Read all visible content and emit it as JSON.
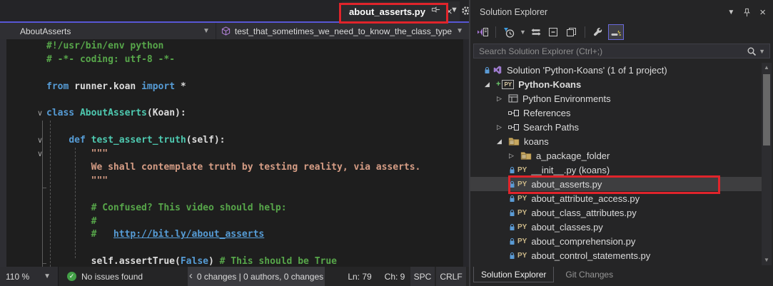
{
  "window": {
    "tab": {
      "title": "about_asserts.py"
    },
    "navbar": {
      "scope": "AboutAsserts",
      "member": "test_that_sometimes_we_need_to_know_the_class_type"
    }
  },
  "editor": {
    "lines": [
      {
        "tokens": [
          [
            "c",
            "#!/usr/bin/env python"
          ]
        ]
      },
      {
        "tokens": [
          [
            "c",
            "# -*- coding: utf-8 -*-"
          ]
        ]
      },
      {
        "tokens": []
      },
      {
        "tokens": [
          [
            "k",
            "from"
          ],
          [
            "p",
            " runner.koan "
          ],
          [
            "k",
            "import"
          ],
          [
            "p",
            " *"
          ]
        ]
      },
      {
        "tokens": []
      },
      {
        "fold": true,
        "tokens": [
          [
            "k",
            "class"
          ],
          [
            "p",
            " "
          ],
          [
            "t",
            "AboutAsserts"
          ],
          [
            "p",
            "(Koan):"
          ]
        ]
      },
      {
        "tokens": []
      },
      {
        "fold": true,
        "tokens": [
          [
            "p",
            "    "
          ],
          [
            "k",
            "def"
          ],
          [
            "p",
            " "
          ],
          [
            "t",
            "test_assert_truth"
          ],
          [
            "p",
            "(self):"
          ]
        ]
      },
      {
        "fold": true,
        "tokens": [
          [
            "s",
            "        \"\"\""
          ]
        ]
      },
      {
        "tokens": [
          [
            "s",
            "        We shall contemplate truth by testing reality, via asserts."
          ]
        ]
      },
      {
        "tokens": [
          [
            "s",
            "        \"\"\""
          ]
        ]
      },
      {
        "tokens": []
      },
      {
        "tokens": [
          [
            "c",
            "        # Confused? This video should help:"
          ]
        ]
      },
      {
        "tokens": [
          [
            "c",
            "        #"
          ]
        ]
      },
      {
        "tokens": [
          [
            "c",
            "        #   "
          ],
          [
            "l",
            "http://bit.ly/about_asserts"
          ]
        ]
      },
      {
        "tokens": []
      },
      {
        "tokens": [
          [
            "p",
            "        self.assertTrue("
          ],
          [
            "k",
            "False"
          ],
          [
            "p",
            ") "
          ],
          [
            "c",
            "# This should be True"
          ]
        ]
      }
    ]
  },
  "status_bar": {
    "zoom": "110 %",
    "message": "No issues found",
    "changes": "0 changes | 0 authors, 0 changes",
    "line": "Ln: 79",
    "column": "Ch: 9",
    "spaces": "SPC",
    "line_endings": "CRLF"
  },
  "solution_explorer": {
    "title": "Solution Explorer",
    "search_placeholder": "Search Solution Explorer (Ctrl+;)",
    "toolbar": [
      {
        "icon": "switch-views-icon"
      },
      {
        "separator": true
      },
      {
        "icon": "pending-changes-filter-icon",
        "dropdown": true
      },
      {
        "icon": "sync-with-active-document-icon"
      },
      {
        "icon": "collapse-all-icon"
      },
      {
        "icon": "show-all-files-icon"
      },
      {
        "separator": true
      },
      {
        "icon": "properties-icon"
      },
      {
        "icon": "track-active-item-icon",
        "active": true
      }
    ],
    "tree": [
      {
        "label": "Solution 'Python-Koans' (1 of 1 project)",
        "icon": "solution-icon",
        "lock": true,
        "indent": 0
      },
      {
        "label": "Python-Koans",
        "icon": "python-project-badge",
        "indent": 1,
        "arrow": "expanded",
        "plus": true,
        "bold": true
      },
      {
        "label": "Python Environments",
        "icon": "python-environments-icon",
        "indent": 2,
        "arrow": "collapsed"
      },
      {
        "label": "References",
        "icon": "references-icon",
        "indent": 2
      },
      {
        "label": "Search Paths",
        "icon": "search-paths-icon",
        "indent": 2,
        "arrow": "collapsed"
      },
      {
        "label": "koans",
        "icon": "package-folder-icon",
        "indent": 2,
        "arrow": "expanded"
      },
      {
        "label": "a_package_folder",
        "icon": "package-folder-icon",
        "indent": 3,
        "arrow": "collapsed"
      },
      {
        "label": "__init__.py (koans)",
        "icon": "python-file-icon",
        "lock": true,
        "indent": 3
      },
      {
        "label": "about_asserts.py",
        "icon": "python-file-icon",
        "lock": true,
        "indent": 3,
        "selected": true
      },
      {
        "label": "about_attribute_access.py",
        "icon": "python-file-icon",
        "lock": true,
        "indent": 3
      },
      {
        "label": "about_class_attributes.py",
        "icon": "python-file-icon",
        "lock": true,
        "indent": 3
      },
      {
        "label": "about_classes.py",
        "icon": "python-file-icon",
        "lock": true,
        "indent": 3
      },
      {
        "label": "about_comprehension.py",
        "icon": "python-file-icon",
        "lock": true,
        "indent": 3
      },
      {
        "label": "about_control_statements.py",
        "icon": "python-file-icon",
        "lock": true,
        "indent": 3
      }
    ],
    "bottom_tabs": [
      {
        "label": "Solution Explorer",
        "active": true
      },
      {
        "label": "Git Changes",
        "active": false
      }
    ]
  },
  "colors": {
    "accent_purple": "#5857D6",
    "annotation_red": "#E0242B",
    "editor_background": "#1E1E1E",
    "panel_background": "#252526",
    "selected_row": "#3E3E40",
    "comment_green": "#57A64A",
    "keyword_blue": "#569CD6",
    "type_teal": "#4EC9B0",
    "string_salmon": "#D69D85"
  }
}
